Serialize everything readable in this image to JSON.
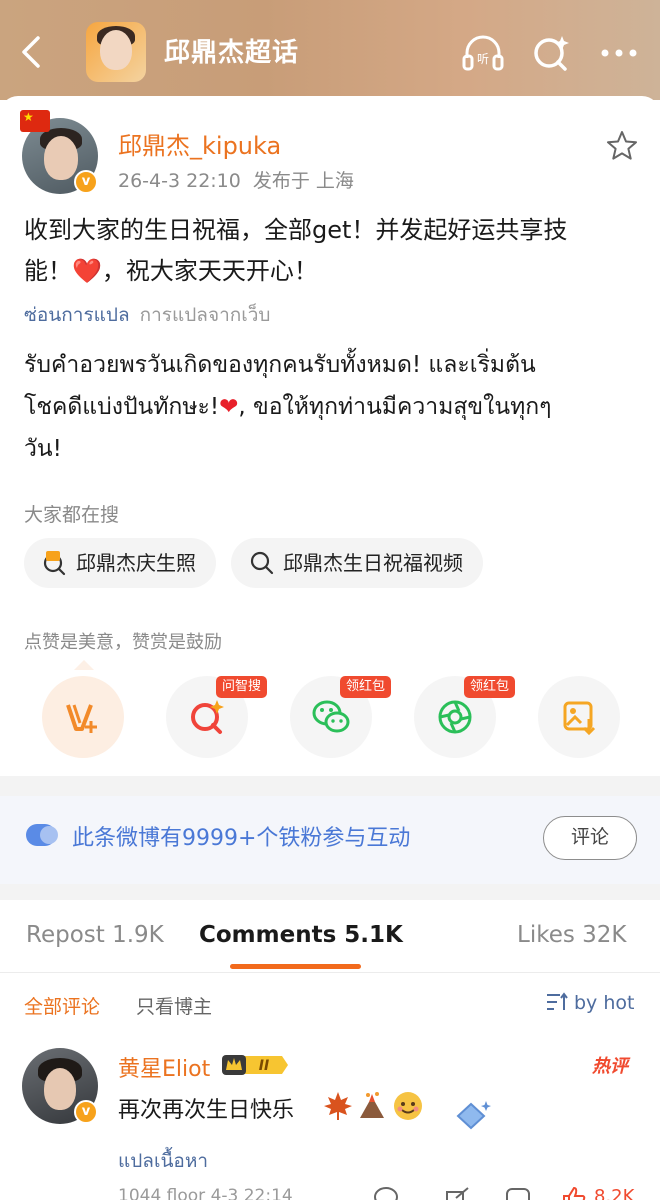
{
  "header": {
    "title": "邱鼎杰超话",
    "listen_label": "听"
  },
  "post": {
    "username": "邱鼎杰_kipuka",
    "date": "26-4-3 22:10",
    "location": "发布于 上海",
    "text_line1": "收到大家的生日祝福，全部get！并发起好运共享技",
    "text_line2_a": "能！",
    "text_line2_heart": "❤️",
    "text_line2_b": "，祝大家天天开心！",
    "translate_link": "ซ่อนการแปล",
    "translate_source": "การแปลจากเว็บ",
    "thai_line1": "รับคำอวยพรวันเกิดของทุกคนรับทั้งหมด! และเริ่มต้น",
    "thai_line2_a": "โชคดีแบ่งปันทักษะ!",
    "thai_line2_heart": "❤",
    "thai_line2_b": ", ขอให้ทุกท่านมีความสุขในทุกๆ",
    "thai_line3": "วัน!"
  },
  "search": {
    "title": "大家都在搜",
    "chips": [
      {
        "label": "邱鼎杰庆生照",
        "icon": "hot-search-icon"
      },
      {
        "label": "邱鼎杰生日祝福视频",
        "icon": "search-icon"
      }
    ]
  },
  "actions": {
    "tip": "点赞是美意，赞赏是鼓励",
    "badges": [
      "问智搜",
      "领红包",
      "领红包"
    ],
    "items": [
      "reward-icon",
      "smart-search-icon",
      "wechat-icon",
      "moments-icon",
      "save-image-icon"
    ]
  },
  "banner": {
    "text": "此条微博有9999+个铁粉参与互动",
    "button": "评论"
  },
  "tabs": {
    "repost": "Repost 1.9K",
    "comments": "Comments 5.1K",
    "likes": "Likes 32K"
  },
  "filters": {
    "all": "全部评论",
    "owner_only": "只看博主",
    "sort": "by hot"
  },
  "comment": {
    "name": "黄星Eliot",
    "level": "II",
    "hot": "热评",
    "text": "再次再次生日快乐",
    "translate": "แปลเนื้อหา",
    "meta": "1044 floor 4-3 22:14",
    "likes": "8.2K"
  },
  "colors": {
    "accent": "#eb7320",
    "link": "#4e6c9e",
    "badge_red": "#f04a2f"
  }
}
